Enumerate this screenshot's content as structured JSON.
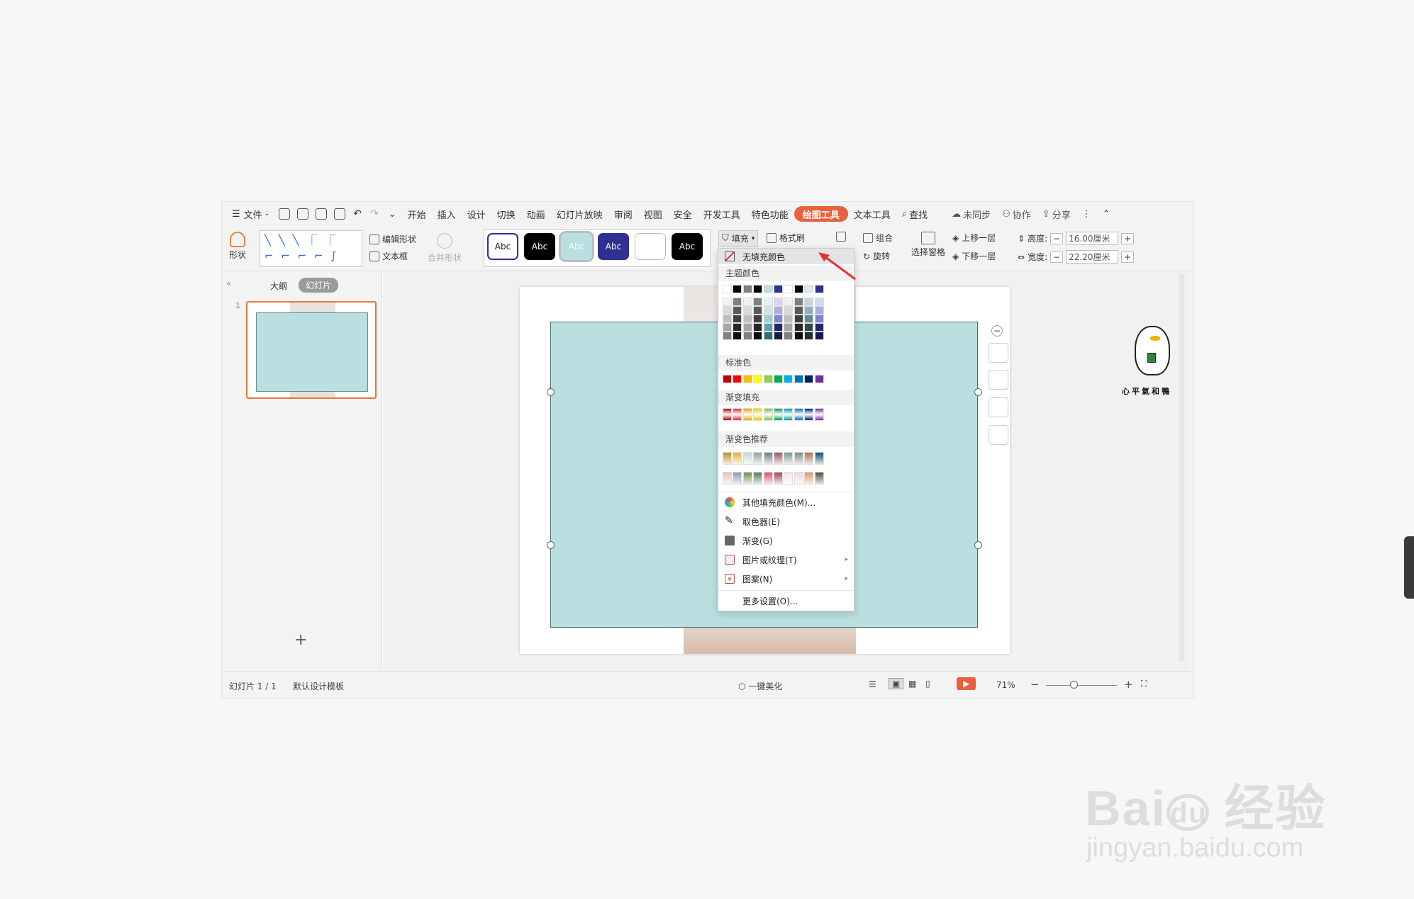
{
  "topbar": {
    "file": "文件",
    "tabs": [
      "开始",
      "插入",
      "设计",
      "切换",
      "动画",
      "幻灯片放映",
      "审阅",
      "视图",
      "安全",
      "开发工具",
      "特色功能",
      "绘图工具",
      "文本工具"
    ],
    "active_tab": "绘图工具",
    "search": "查找",
    "sync": "未同步",
    "collab": "协作",
    "share": "分享"
  },
  "ribbon": {
    "shape": "形状",
    "edit_shape": "编辑形状",
    "textbox": "文本框",
    "merge_shape": "合并形状",
    "style_previews": [
      "Abc",
      "Abc",
      "Abc",
      "Abc",
      "",
      "Abc"
    ],
    "fill": "填充",
    "format_brush": "格式刷",
    "group": "组合",
    "rotate": "旋转",
    "selection_pane": "选择窗格",
    "bring_forward": "上移一层",
    "send_backward": "下移一层",
    "height_label": "高度:",
    "height_value": "16.00厘米",
    "width_label": "宽度:",
    "width_value": "22.20厘米"
  },
  "panel": {
    "tab_outline": "大纲",
    "tab_slides": "幻灯片",
    "slide_number": "1",
    "add": "+"
  },
  "status": {
    "slide_info": "幻灯片 1 / 1",
    "template": "默认设计模板",
    "beautify": "一键美化",
    "zoom": "71%"
  },
  "fill_menu": {
    "no_fill": "无填充颜色",
    "theme_colors_title": "主题颜色",
    "standard_title": "标准色",
    "gradient_title": "渐变填充",
    "gradient_rec_title": "渐变色推荐",
    "items": [
      "其他填充颜色(M)...",
      "取色器(E)",
      "渐变(G)",
      "图片或纹理(T)",
      "图案(N)"
    ],
    "more": "更多设置(O)...",
    "theme_top": [
      "#ffffff",
      "#000000",
      "#7f7f7f",
      "#000000",
      "#b9dfe1",
      "#2e3192",
      "#ffffff",
      "#000000",
      "#dde8ea",
      "#2e3192"
    ],
    "theme_cols": [
      [
        "#f2f2f2",
        "#d9d9d9",
        "#bfbfbf",
        "#a6a6a6",
        "#808080"
      ],
      [
        "#7f7f7f",
        "#595959",
        "#404040",
        "#262626",
        "#0d0d0d"
      ],
      [
        "#f2f2f2",
        "#d9d9d9",
        "#bfbfbf",
        "#a6a6a6",
        "#808080"
      ],
      [
        "#7f7f7f",
        "#595959",
        "#404040",
        "#262626",
        "#0d0d0d"
      ],
      [
        "#e3f2f3",
        "#c7e5e7",
        "#9fd1d4",
        "#5aa5a9",
        "#2e6e71"
      ],
      [
        "#d5d6f0",
        "#abade1",
        "#8184d2",
        "#232670",
        "#171a4b"
      ],
      [
        "#f2f2f2",
        "#d9d9d9",
        "#bfbfbf",
        "#a6a6a6",
        "#808080"
      ],
      [
        "#7f7f7f",
        "#595959",
        "#404040",
        "#262626",
        "#0d0d0d"
      ],
      [
        "#c4d7db",
        "#8fb2b8",
        "#5f8d94",
        "#2f4a4f",
        "#1d3033"
      ],
      [
        "#d5d6f0",
        "#abade1",
        "#8184d2",
        "#232670",
        "#171a4b"
      ]
    ],
    "standard": [
      "#c00000",
      "#ff0000",
      "#ffc000",
      "#ffff00",
      "#92d050",
      "#00b050",
      "#00b0f0",
      "#0070c0",
      "#002060",
      "#7030a0"
    ],
    "gradients": [
      "#c00000",
      "#e03030",
      "#e6a700",
      "#e0d000",
      "#7cc040",
      "#00a050",
      "#00a0a0",
      "#0070c0",
      "#002080",
      "#7030a0"
    ],
    "gradient_rec_row1": [
      "#b5922e",
      "#e2b04a",
      "#c8d8d4",
      "#95a59c",
      "#6a7a8c",
      "#a0506a",
      "#7a9c84",
      "#7c8c8a",
      "#b07050",
      "#104c6c"
    ],
    "gradient_rec_row2": [
      "#e8c0b8",
      "#8898b8",
      "#7a8a50",
      "#5a7a60",
      "#e05070",
      "#9a4a5a",
      "#f0e8e0",
      "#e8d8e0",
      "#e09860",
      "#5a4a40"
    ]
  }
}
